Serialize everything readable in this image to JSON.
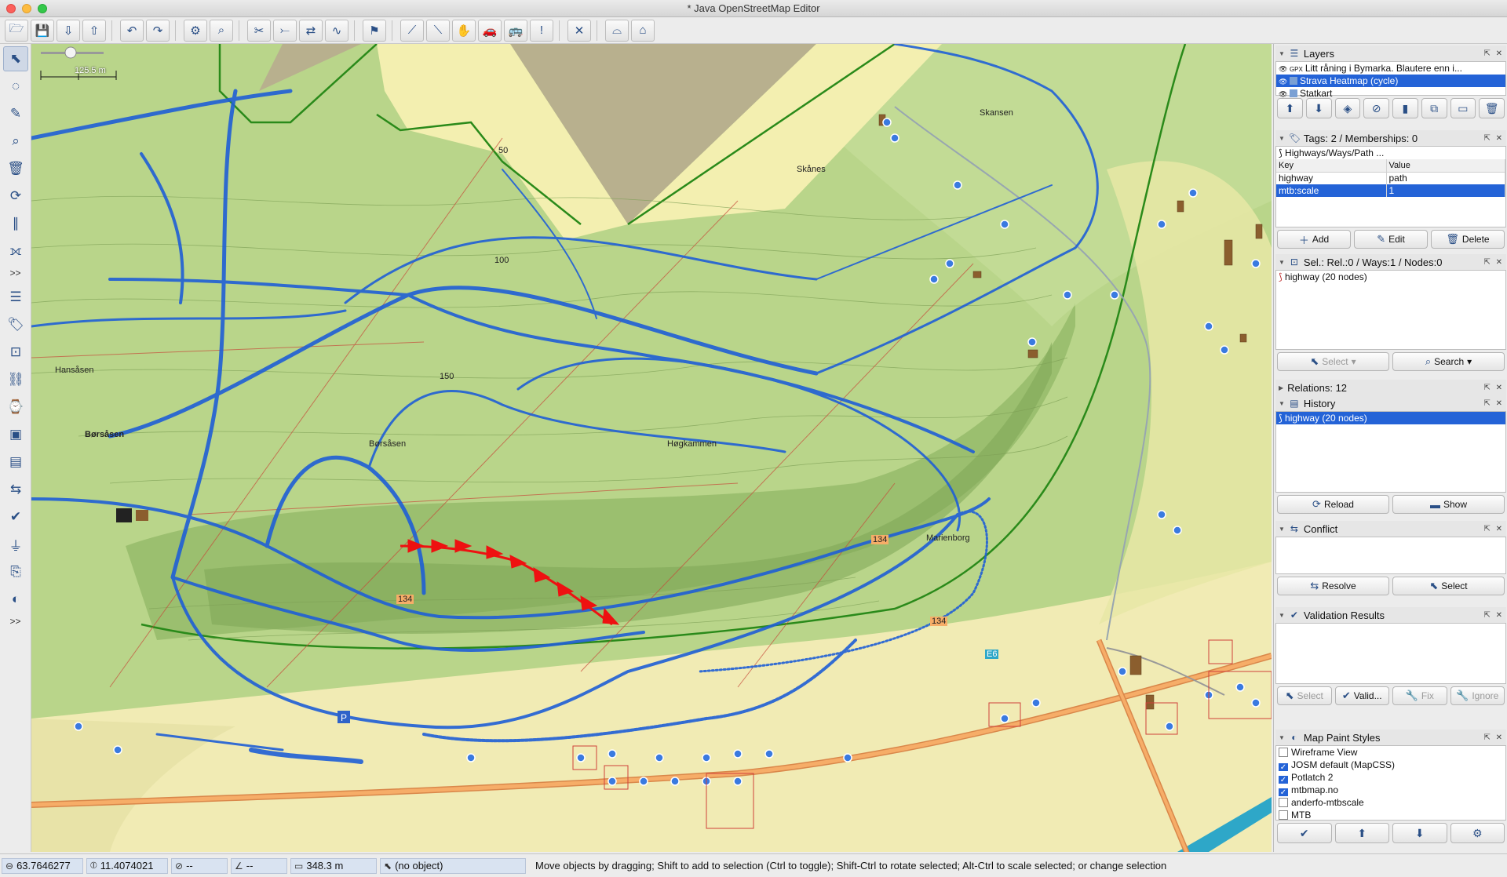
{
  "window": {
    "title": "* Java OpenStreetMap Editor"
  },
  "toolbar": {
    "buttons": [
      {
        "name": "open-file-icon",
        "glyph": "🗁"
      },
      {
        "name": "save-icon",
        "glyph": "💾"
      },
      {
        "name": "download-icon",
        "glyph": "⇩"
      },
      {
        "name": "upload-icon",
        "glyph": "⇧"
      },
      {
        "name": "undo-icon",
        "glyph": "↶"
      },
      {
        "name": "redo-icon",
        "glyph": "↷"
      },
      {
        "name": "preferences-icon",
        "glyph": "⚙"
      },
      {
        "name": "zoom-to-data-icon",
        "glyph": "⌕"
      },
      {
        "name": "split-way-icon",
        "glyph": "✂"
      },
      {
        "name": "combine-way-icon",
        "glyph": "⤚"
      },
      {
        "name": "reverse-way-icon",
        "glyph": "⇄"
      },
      {
        "name": "simplify-way-icon",
        "glyph": "∿"
      },
      {
        "name": "preset-highway-icon",
        "glyph": "⚑"
      },
      {
        "name": "preset-track-icon",
        "glyph": "⟋"
      },
      {
        "name": "preset-path-icon",
        "glyph": "⟍"
      },
      {
        "name": "preset-hand-icon",
        "glyph": "✋"
      },
      {
        "name": "preset-car-icon",
        "glyph": "🚗"
      },
      {
        "name": "preset-bus-icon",
        "glyph": "🚌"
      },
      {
        "name": "preset-warning-icon",
        "glyph": "!"
      },
      {
        "name": "preset-crossing-icon",
        "glyph": "✕"
      },
      {
        "name": "preset-bridge-icon",
        "glyph": "⌓"
      },
      {
        "name": "preset-building-icon",
        "glyph": "⌂"
      }
    ]
  },
  "left_tools": [
    {
      "name": "select-tool-icon",
      "glyph": "⬉",
      "active": true
    },
    {
      "name": "lasso-tool-icon",
      "glyph": "◌",
      "active": false
    },
    {
      "name": "draw-tool-icon",
      "glyph": "✎",
      "active": false
    },
    {
      "name": "zoom-tool-icon",
      "glyph": "⌕",
      "active": false
    },
    {
      "name": "delete-tool-icon",
      "glyph": "🗑",
      "active": false
    },
    {
      "name": "improve-way-tool-icon",
      "glyph": "⟳",
      "active": false
    },
    {
      "name": "parallel-way-tool-icon",
      "glyph": "∥",
      "active": false
    },
    {
      "name": "extrude-tool-icon",
      "glyph": "⟗",
      "active": false
    }
  ],
  "left_tools_more": ">>",
  "left_dialogs": [
    {
      "name": "layers-toggle-icon",
      "glyph": "☰"
    },
    {
      "name": "tags-toggle-icon",
      "glyph": "🏷"
    },
    {
      "name": "selection-toggle-icon",
      "glyph": "⊡"
    },
    {
      "name": "relations-toggle-icon",
      "glyph": "⛓"
    },
    {
      "name": "history-toggle-icon",
      "glyph": "⌚"
    },
    {
      "name": "minimap-toggle-icon",
      "glyph": "▣"
    },
    {
      "name": "imagery-toggle-icon",
      "glyph": "▤"
    },
    {
      "name": "conflict-toggle-icon",
      "glyph": "⇆"
    },
    {
      "name": "validation-toggle-icon",
      "glyph": "✔"
    },
    {
      "name": "filter-toggle-icon",
      "glyph": "⏚"
    },
    {
      "name": "changeset-toggle-icon",
      "glyph": "⎘"
    },
    {
      "name": "mapstyle-toggle-icon",
      "glyph": "◐"
    }
  ],
  "left_dialogs_more": ">>",
  "map": {
    "scale_text": "125.5 m",
    "labels": [
      {
        "id": "hansasen",
        "text": "Hansåsen"
      },
      {
        "id": "borsasen",
        "text": "Børsåsen"
      },
      {
        "id": "borsasen2",
        "text": "Børsåsen"
      },
      {
        "id": "hogkammen",
        "text": "Høgkammen"
      },
      {
        "id": "skansen",
        "text": "Skansen"
      },
      {
        "id": "skanes",
        "text": "Skånes"
      },
      {
        "id": "marienborg",
        "text": "Marienborg"
      },
      {
        "id": "road134a",
        "text": "134"
      },
      {
        "id": "road134b",
        "text": "134"
      },
      {
        "id": "road134c",
        "text": "134"
      },
      {
        "id": "e6",
        "text": "E6"
      },
      {
        "id": "c100",
        "text": "100"
      },
      {
        "id": "c150",
        "text": "150"
      },
      {
        "id": "c50",
        "text": "50"
      }
    ]
  },
  "layers": {
    "title": "Layers",
    "items": [
      {
        "label": "Litt råning i Bymarka. Blautere enn i...",
        "type": "GPX",
        "selected": false
      },
      {
        "label": "Strava Heatmap (cycle)",
        "type": "img",
        "selected": true
      },
      {
        "label": "Statkart",
        "type": "img",
        "selected": false
      }
    ]
  },
  "tags": {
    "title": "Tags: 2 / Memberships: 0",
    "preset": "Highways/Ways/Path ...",
    "col_key": "Key",
    "col_value": "Value",
    "rows": [
      {
        "key": "highway",
        "value": "path",
        "selected": false
      },
      {
        "key": "mtb:scale",
        "value": "1",
        "selected": true
      }
    ],
    "add": "Add",
    "edit": "Edit",
    "delete": "Delete"
  },
  "selection": {
    "title": "Sel.: Rel.:0 / Ways:1 / Nodes:0",
    "items": [
      "highway (20 nodes)"
    ],
    "select": "Select",
    "search": "Search"
  },
  "relations": {
    "title": "Relations: 12"
  },
  "history": {
    "title": "History",
    "items": [
      "highway (20 nodes)"
    ],
    "reload": "Reload",
    "show": "Show"
  },
  "conflict": {
    "title": "Conflict",
    "resolve": "Resolve",
    "select": "Select"
  },
  "validation": {
    "title": "Validation Results",
    "select": "Select",
    "validate": "Valid...",
    "fix": "Fix",
    "ignore": "Ignore"
  },
  "map_paint_styles": {
    "title": "Map Paint Styles",
    "items": [
      {
        "label": "Wireframe View",
        "checked": false
      },
      {
        "label": "JOSM default (MapCSS)",
        "checked": true
      },
      {
        "label": "Potlatch 2",
        "checked": true
      },
      {
        "label": "mtbmap.no",
        "checked": true
      },
      {
        "label": "anderfo-mtbscale",
        "checked": false
      },
      {
        "label": "MTB",
        "checked": false
      }
    ]
  },
  "status": {
    "lat": "63.7646277",
    "lon": "11.4074021",
    "heading": "--",
    "angle": "--",
    "distance": "348.3 m",
    "object": "(no object)",
    "message": "Move objects by dragging; Shift to add to selection (Ctrl to toggle); Shift-Ctrl to rotate selected; Alt-Ctrl to scale selected; or change selection"
  },
  "colors": {
    "heatmap": "#1f5fd6",
    "selected_way": "#ee1111",
    "road": "#f5a15a",
    "forest": "#b9d58a",
    "selection": "#2463d7"
  }
}
